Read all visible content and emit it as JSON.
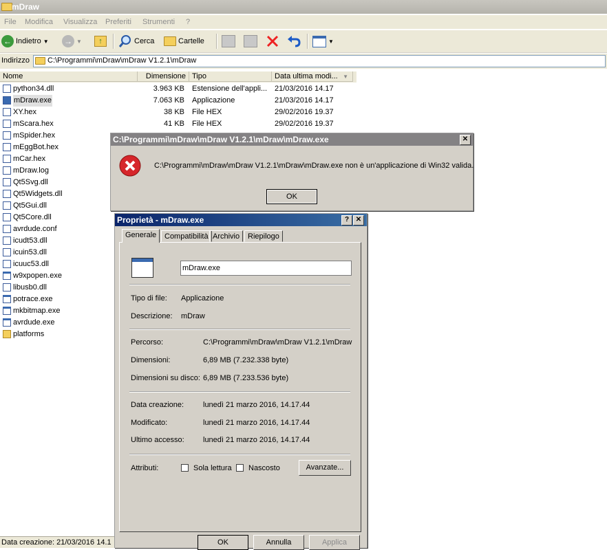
{
  "window": {
    "title": "mDraw"
  },
  "menu": [
    "File",
    "Modifica",
    "Visualizza",
    "Preferiti",
    "Strumenti",
    "?"
  ],
  "toolbar": {
    "back": "Indietro",
    "search": "Cerca",
    "folders": "Cartelle"
  },
  "address": {
    "label": "Indirizzo",
    "value": "C:\\Programmi\\mDraw\\mDraw V1.2.1\\mDraw"
  },
  "columns": {
    "name": "Nome",
    "size": "Dimensione",
    "type": "Tipo",
    "date": "Data ultima modi..."
  },
  "files": [
    {
      "name": "python34.dll",
      "size": "3.963 KB",
      "type": "Estensione dell'appli...",
      "date": "21/03/2016 14.17"
    },
    {
      "name": "mDraw.exe",
      "size": "7.063 KB",
      "type": "Applicazione",
      "date": "21/03/2016 14.17"
    },
    {
      "name": "XY.hex",
      "size": "38 KB",
      "type": "File HEX",
      "date": "29/02/2016 19.37"
    },
    {
      "name": "mScara.hex",
      "size": "41 KB",
      "type": "File HEX",
      "date": "29/02/2016 19.37"
    },
    {
      "name": "mSpider.hex"
    },
    {
      "name": "mEggBot.hex"
    },
    {
      "name": "mCar.hex"
    },
    {
      "name": "mDraw.log"
    },
    {
      "name": "Qt5Svg.dll"
    },
    {
      "name": "Qt5Widgets.dll"
    },
    {
      "name": "Qt5Gui.dll"
    },
    {
      "name": "Qt5Core.dll"
    },
    {
      "name": "avrdude.conf"
    },
    {
      "name": "icudt53.dll"
    },
    {
      "name": "icuin53.dll"
    },
    {
      "name": "icuuc53.dll"
    },
    {
      "name": "w9xpopen.exe"
    },
    {
      "name": "libusb0.dll"
    },
    {
      "name": "potrace.exe"
    },
    {
      "name": "mkbitmap.exe"
    },
    {
      "name": "avrdude.exe"
    },
    {
      "name": "platforms"
    }
  ],
  "status": "Data creazione: 21/03/2016 14.1",
  "error_dialog": {
    "title": "C:\\Programmi\\mDraw\\mDraw V1.2.1\\mDraw\\mDraw.exe",
    "message": "C:\\Programmi\\mDraw\\mDraw V1.2.1\\mDraw\\mDraw.exe non è un'applicazione di Win32 valida.",
    "ok": "OK"
  },
  "props": {
    "title": "Proprietà - mDraw.exe",
    "help": "?",
    "tabs": [
      "Generale",
      "Compatibilità",
      "Archivio",
      "Riepilogo"
    ],
    "filename": "mDraw.exe",
    "type_label": "Tipo di file:",
    "type_value": "Applicazione",
    "desc_label": "Descrizione:",
    "desc_value": "mDraw",
    "path_label": "Percorso:",
    "path_value": "C:\\Programmi\\mDraw\\mDraw V1.2.1\\mDraw",
    "size_label": "Dimensioni:",
    "size_value": "6,89 MB (7.232.338 byte)",
    "disk_label": "Dimensioni su disco:",
    "disk_value": "6,89 MB (7.233.536 byte)",
    "created_label": "Data creazione:",
    "created_value": "lunedì 21 marzo 2016, 14.17.44",
    "modified_label": "Modificato:",
    "modified_value": "lunedì 21 marzo 2016, 14.17.44",
    "accessed_label": "Ultimo accesso:",
    "accessed_value": "lunedì 21 marzo 2016, 14.17.44",
    "attr_label": "Attributi:",
    "readonly": "Sola lettura",
    "hidden": "Nascosto",
    "advanced": "Avanzate...",
    "ok": "OK",
    "cancel": "Annulla",
    "apply": "Applica"
  },
  "colors": {
    "title_active": "#0a246a",
    "title_inactive": "#848284",
    "error_red": "#d6262b"
  }
}
